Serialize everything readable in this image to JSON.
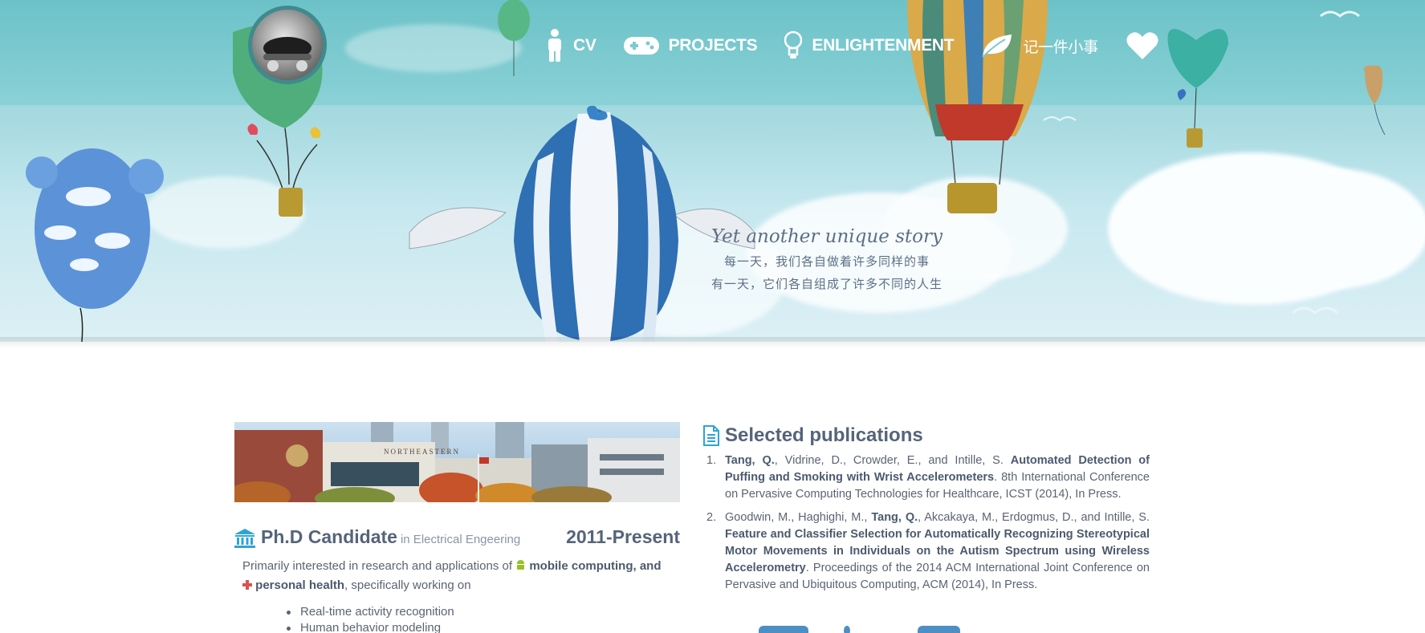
{
  "nav": {
    "items": [
      {
        "label": "CV",
        "icon": "person-icon"
      },
      {
        "label": "PROJECTS",
        "icon": "gamepad-icon"
      },
      {
        "label": "ENLIGHTENMENT",
        "icon": "lightbulb-icon"
      },
      {
        "label": "记一件小事",
        "icon": "leaf-icon"
      }
    ],
    "heart_icon": "heart-icon"
  },
  "hero": {
    "tagline_en": "Yet another unique story",
    "tagline_cn_1": "每一天，我们各自做着许多同样的事",
    "tagline_cn_2": "有一天，它们各自组成了许多不同的人生"
  },
  "position": {
    "title": "Ph.D Candidate",
    "subtitle": "in Electrical Engeering",
    "years": "2011-Present",
    "intro_start": "Primarily interested in research and applications of",
    "intro_mobile": "mobile computing, and",
    "intro_health": "personal health",
    "intro_end": ", specifically working on",
    "bullets": [
      "Real-time activity recognition",
      "Human behavior modeling"
    ],
    "campus_sign": "NORTHEASTERN"
  },
  "publications": {
    "heading": "Selected publications",
    "items": [
      {
        "num": "1.",
        "me": "Tang, Q.",
        "authors_rest": ", Vidrine, D., Crowder, E., and Intille, S. ",
        "title": "Automated Detection of Puffing and Smoking with Wrist Accelerometers",
        "venue": ". 8th International Conference on Pervasive Computing Technologies for Healthcare, ICST (2014), In Press."
      },
      {
        "num": "2.",
        "authors_pre": "Goodwin, M., Haghighi, M., ",
        "me": "Tang, Q.",
        "authors_rest": ", Akcakaya, M., Erdogmus, D., and Intille, S. ",
        "title": "Feature and Classifier Selection for Automatically Recognizing Stereotypical Motor Movements in Individuals on the Autism Spectrum using Wireless Accelerometry",
        "venue": ". Proceedings of the 2014 ACM International Joint Conference on Pervasive and Ubiquitous Computing, ACM (2014), In Press."
      }
    ]
  },
  "colors": {
    "accent": "#2fa3d6",
    "heading": "#56647a",
    "text": "#5a6472",
    "android": "#97c024",
    "health": "#d9534f"
  }
}
